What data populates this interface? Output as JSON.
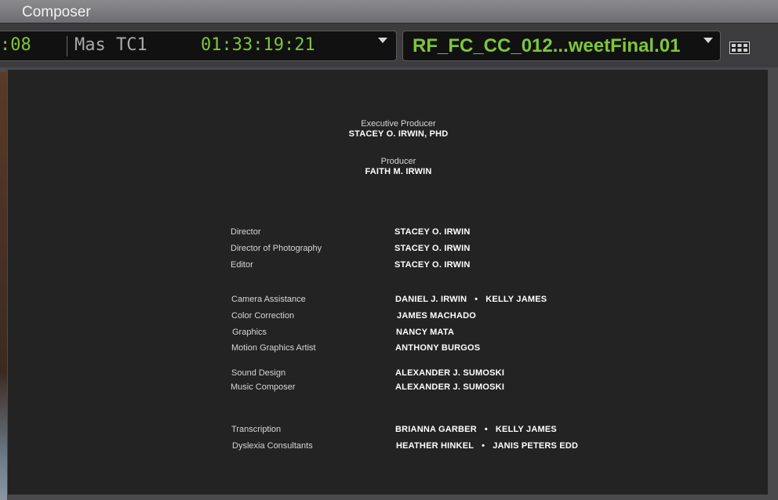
{
  "window": {
    "title": "Composer"
  },
  "timecode_bar": {
    "left_value": ":08",
    "label": "Mas TC1",
    "value": "01:33:19:21"
  },
  "clip_bar": {
    "clip_name": "RF_FC_CC_012...weetFinal.01"
  },
  "colors": {
    "accent_green": "#7fc638",
    "viewer_bg": "#232324"
  },
  "credits": {
    "executive_producer": {
      "role": "Executive Producer",
      "name": "STACEY O. IRWIN, PHD"
    },
    "producer": {
      "role": "Producer",
      "name": "FAITH M. IRWIN"
    },
    "rows": [
      {
        "role": "Director",
        "names": [
          "STACEY O. IRWIN"
        ]
      },
      {
        "role": "Director of Photography",
        "names": [
          "STACEY O. IRWIN"
        ]
      },
      {
        "role": "Editor",
        "names": [
          "STACEY O. IRWIN"
        ]
      },
      {
        "role": "Camera Assistance",
        "names": [
          "DANIEL J. IRWIN",
          "KELLY JAMES"
        ]
      },
      {
        "role": "Color Correction",
        "names": [
          "JAMES MACHADO"
        ]
      },
      {
        "role": "Graphics",
        "names": [
          "NANCY MATA"
        ]
      },
      {
        "role": "Motion Graphics Artist",
        "names": [
          "ANTHONY BURGOS"
        ]
      },
      {
        "role": "Sound Design",
        "names": [
          "ALEXANDER J. SUMOSKI"
        ]
      },
      {
        "role": "Music Composer",
        "names": [
          "ALEXANDER J. SUMOSKI"
        ]
      },
      {
        "role": "Transcription",
        "names": [
          "BRIANNA GARBER",
          "KELLY JAMES"
        ]
      },
      {
        "role": "Dyslexia Consultants",
        "names": [
          "HEATHER HINKEL",
          "JANIS PETERS EDD"
        ]
      }
    ],
    "separator": "•"
  },
  "icons": {
    "timecode_dropdown": "chevron-down-icon",
    "clip_dropdown": "chevron-down-icon",
    "menu": "grid-menu-icon"
  }
}
